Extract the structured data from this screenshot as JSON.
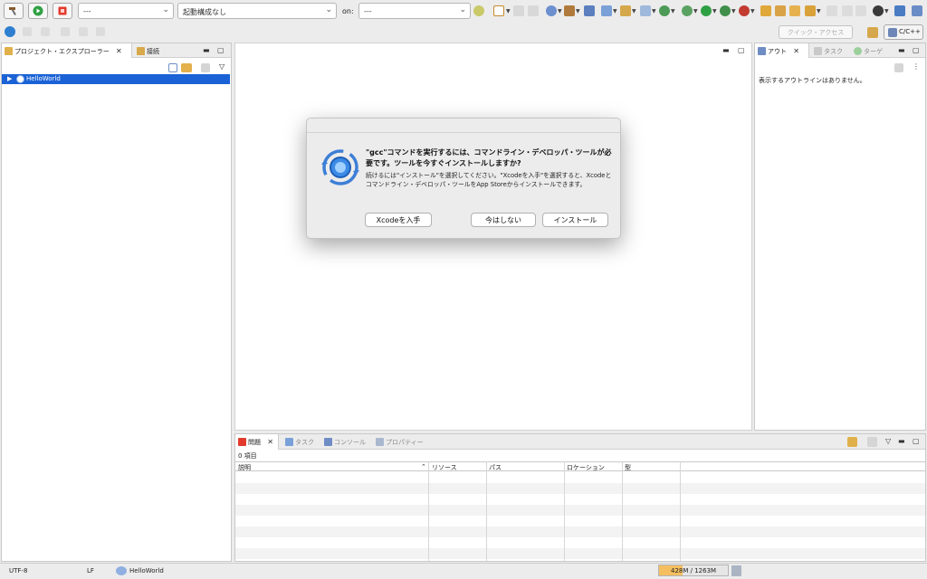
{
  "toolbar": {
    "build_icon": "hammer-icon",
    "run_icon": "run-icon",
    "stop_icon": "stop-icon",
    "launch_mode_value": "---",
    "launch_config_value": "起動構成なし",
    "on_label": "on:",
    "launch_target_value": "---"
  },
  "quick_access": {
    "placeholder": "クイック・アクセス"
  },
  "perspective": {
    "label": "C/C++"
  },
  "left_panel": {
    "tabs": [
      {
        "label": "プロジェクト・エクスプローラー"
      },
      {
        "label": "接続"
      }
    ],
    "tree": [
      {
        "label": "HelloWorld"
      }
    ]
  },
  "right_panel": {
    "tabs": [
      {
        "label": "アウト"
      },
      {
        "label": "タスク"
      },
      {
        "label": "ターゲ"
      }
    ],
    "empty_message": "表示するアウトラインはありません。"
  },
  "bottom_panel": {
    "tabs": [
      {
        "label": "問題"
      },
      {
        "label": "タスク"
      },
      {
        "label": "コンソール"
      },
      {
        "label": "プロパティー"
      }
    ],
    "count": "0 項目",
    "columns": [
      {
        "label": "説明"
      },
      {
        "label": "リソース"
      },
      {
        "label": "パス"
      },
      {
        "label": "ロケーション"
      },
      {
        "label": "型"
      }
    ]
  },
  "status_bar": {
    "encoding": "UTF-8",
    "line_ending": "LF",
    "project": "HelloWorld",
    "heap": "428M / 1263M",
    "heap_used_fraction": 0.34
  },
  "dialog": {
    "title": "\"gcc\"コマンドを実行するには、コマンドライン・デベロッパ・ツールが必要です。ツールを今すぐインストールしますか?",
    "body": "続けるには\"インストール\"を選択してください。\"Xcodeを入手\"を選択すると、Xcodeとコマンドライン・デベロッパ・ツールをApp Storeからインストールできます。",
    "buttons": {
      "get_xcode": "Xcodeを入手",
      "not_now": "今はしない",
      "install": "インストール"
    }
  },
  "colors": {
    "selection": "#1a62d6",
    "run_green": "#2ea043",
    "stop_red": "#e23b2e",
    "heap_fill": "#f5bf5f"
  }
}
